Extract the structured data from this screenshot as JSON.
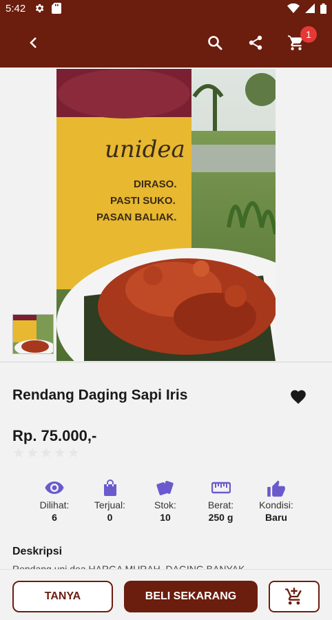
{
  "status_bar": {
    "time": "5:42"
  },
  "app_bar": {
    "cart_count": "1"
  },
  "product": {
    "name": "Rendang Daging Sapi Iris",
    "price": "Rp. 75.000,-",
    "rating": 0,
    "max_rating": 5,
    "package_brand": "unidea",
    "package_text": "DIRASO, PASTI SUKO, PASAN BALIAK."
  },
  "stats": [
    {
      "icon": "eye-icon",
      "label": "Dilihat:",
      "value": "6"
    },
    {
      "icon": "shopping-bag-icon",
      "label": "Terjual:",
      "value": "0"
    },
    {
      "icon": "cards-stack-icon",
      "label": "Stok:",
      "value": "10"
    },
    {
      "icon": "ruler-icon",
      "label": "Berat:",
      "value": "250 g"
    },
    {
      "icon": "thumb-up-icon",
      "label": "Kondisi:",
      "value": "Baru"
    }
  ],
  "description": {
    "title": "Deskripsi",
    "text": "Rendang uni dea HARGA MURAH, DAGING BANYAK"
  },
  "actions": {
    "ask": "TANYA",
    "buy_now": "BELI SEKARANG",
    "add_to_cart_icon": "add-to-cart-icon"
  },
  "colors": {
    "primary": "#6b1d0e",
    "accent": "#6a5acd",
    "badge": "#e53935"
  }
}
